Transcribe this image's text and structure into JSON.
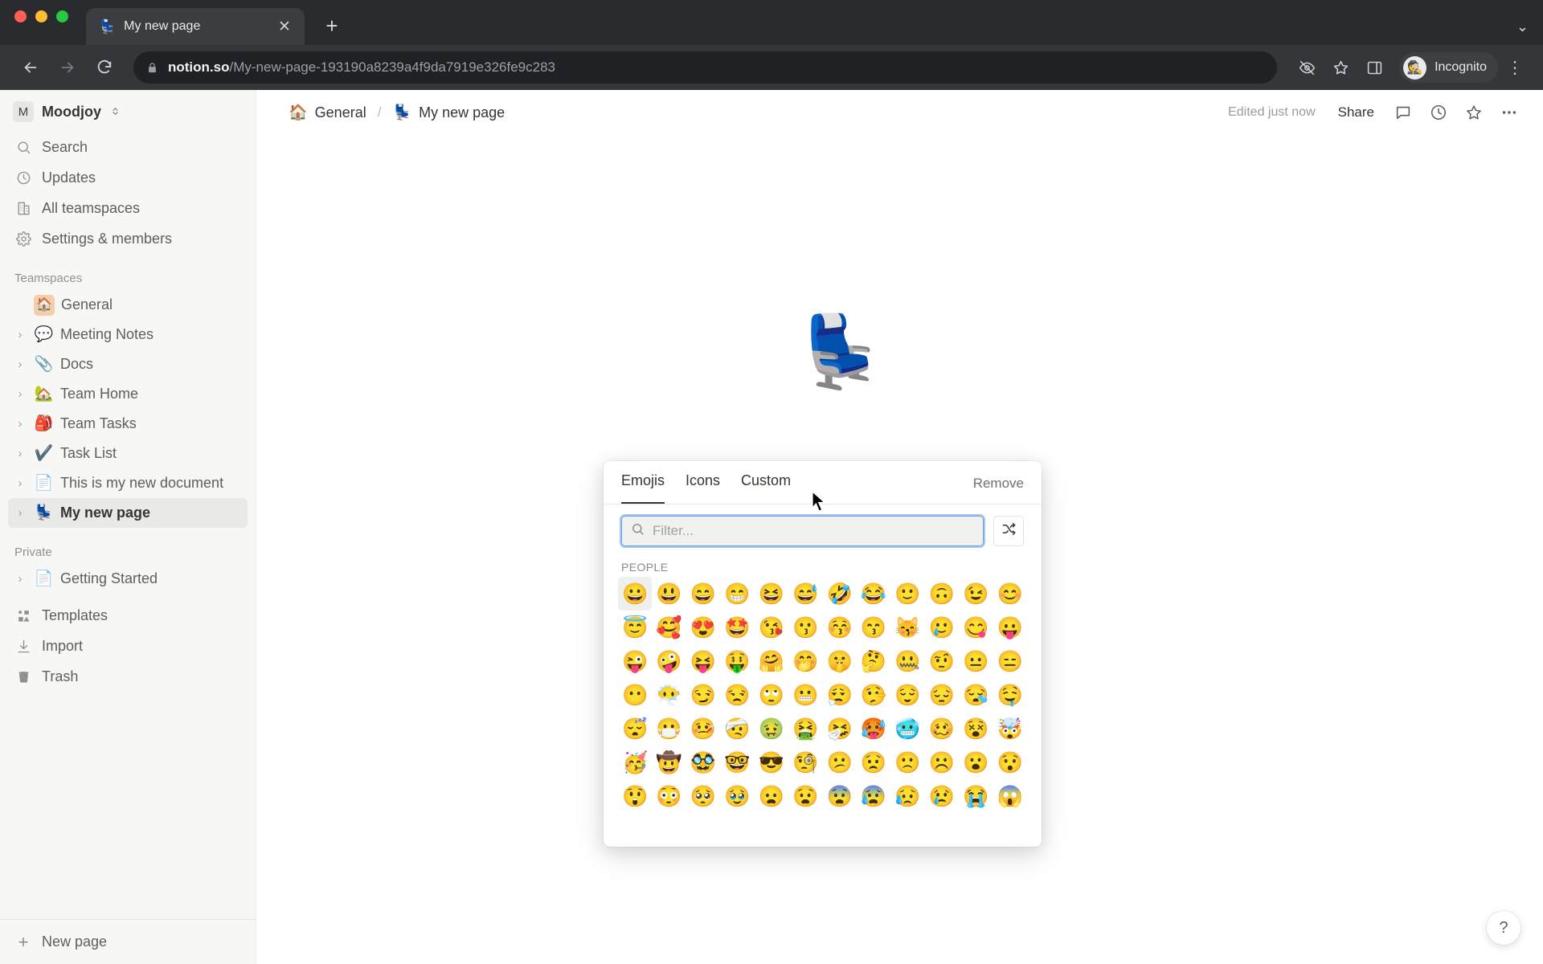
{
  "browser": {
    "tab": {
      "favicon": "💺",
      "title": "My new page",
      "close_label": "✕"
    },
    "new_tab_label": "+",
    "tabstrip_menu": "⌄",
    "url": {
      "host": "notion.so",
      "path": "/My-new-page-193190a8239a4f9da7919e326fe9c283",
      "lock_icon": "lock-icon"
    },
    "profile": {
      "label": "Incognito",
      "avatar_glyph": "🕵"
    },
    "menu_glyph": "⋮"
  },
  "sidebar": {
    "workspace": {
      "initial": "M",
      "name": "Moodjoy",
      "chevron": "⌃⌄"
    },
    "nav": [
      {
        "icon": "search-icon",
        "label": "Search"
      },
      {
        "icon": "clock-icon",
        "label": "Updates"
      },
      {
        "icon": "building-icon",
        "label": "All teamspaces"
      },
      {
        "icon": "gear-icon",
        "label": "Settings & members"
      }
    ],
    "teamspaces_label": "Teamspaces",
    "teamspaces": [
      {
        "emoji": "🏠",
        "label": "General",
        "caret": false,
        "boxed": true,
        "selected": false
      },
      {
        "emoji": "💬",
        "label": "Meeting Notes",
        "caret": true,
        "boxed": false,
        "selected": false
      },
      {
        "emoji": "📎",
        "label": "Docs",
        "caret": true,
        "boxed": false,
        "selected": false
      },
      {
        "emoji": "🏡",
        "label": "Team Home",
        "caret": true,
        "boxed": false,
        "selected": false
      },
      {
        "emoji": "🎒",
        "label": "Team Tasks",
        "caret": true,
        "boxed": false,
        "selected": false
      },
      {
        "emoji": "✔️",
        "label": "Task List",
        "caret": true,
        "boxed": false,
        "selected": false
      },
      {
        "emoji": "📄",
        "label": "This is my new document",
        "caret": true,
        "boxed": false,
        "selected": false
      },
      {
        "emoji": "💺",
        "label": "My new page",
        "caret": true,
        "boxed": false,
        "selected": true
      }
    ],
    "private_label": "Private",
    "private": [
      {
        "emoji": "📄",
        "label": "Getting Started",
        "caret": true,
        "boxed": false,
        "selected": false
      }
    ],
    "bottom": [
      {
        "icon": "templates-icon",
        "label": "Templates"
      },
      {
        "icon": "import-icon",
        "label": "Import"
      },
      {
        "icon": "trash-icon",
        "label": "Trash"
      }
    ],
    "new_page": {
      "icon": "plus-icon",
      "label": "New page"
    }
  },
  "topbar": {
    "breadcrumb": [
      {
        "emoji": "🏠",
        "label": "General"
      },
      {
        "emoji": "💺",
        "label": "My new page"
      }
    ],
    "separator": "/",
    "edited": "Edited just now",
    "share_label": "Share",
    "icons": [
      "comment-icon",
      "history-icon",
      "star-icon",
      "more-icon"
    ]
  },
  "page": {
    "icon": "💺"
  },
  "picker": {
    "tabs": [
      {
        "label": "Emojis",
        "active": true
      },
      {
        "label": "Icons",
        "active": false
      },
      {
        "label": "Custom",
        "active": false
      }
    ],
    "remove_label": "Remove",
    "filter": {
      "value": "",
      "placeholder": "Filter...",
      "icon": "search-icon"
    },
    "shuffle_icon": "shuffle-icon",
    "category_label": "PEOPLE",
    "emojis": [
      "😀",
      "😃",
      "😄",
      "😁",
      "😆",
      "😅",
      "🤣",
      "😂",
      "🙂",
      "🙃",
      "😉",
      "😊",
      "😇",
      "🥰",
      "😍",
      "🤩",
      "😘",
      "😗",
      "😚",
      "😙",
      "😽",
      "🥲",
      "😋",
      "😛",
      "😜",
      "🤪",
      "😝",
      "🤑",
      "🤗",
      "🤭",
      "🤫",
      "🤔",
      "🤐",
      "🤨",
      "😐",
      "😑",
      "😶",
      "😶‍🌫️",
      "😏",
      "😒",
      "🙄",
      "😬",
      "😮‍💨",
      "🤥",
      "😌",
      "😔",
      "😪",
      "🤤",
      "😴",
      "😷",
      "🤒",
      "🤕",
      "🤢",
      "🤮",
      "🤧",
      "🥵",
      "🥶",
      "🥴",
      "😵",
      "🤯",
      "🥳",
      "🤠",
      "🥸",
      "🤓",
      "😎",
      "🧐",
      "😕",
      "😟",
      "🙁",
      "☹️",
      "😮",
      "😯",
      "😲",
      "😳",
      "🥺",
      "🥹",
      "😦",
      "😧",
      "😨",
      "😰",
      "😥",
      "😢",
      "😭",
      "😱"
    ],
    "highlighted_index": 0
  },
  "help": {
    "label": "?"
  },
  "colors": {
    "accent_focus": "#6aa0ea",
    "sidebar_bg": "#f7f7f5",
    "selected_row": "#e9e9e7",
    "text_primary": "#37352f",
    "text_secondary": "#5f5e5b",
    "text_muted": "#91918e"
  }
}
